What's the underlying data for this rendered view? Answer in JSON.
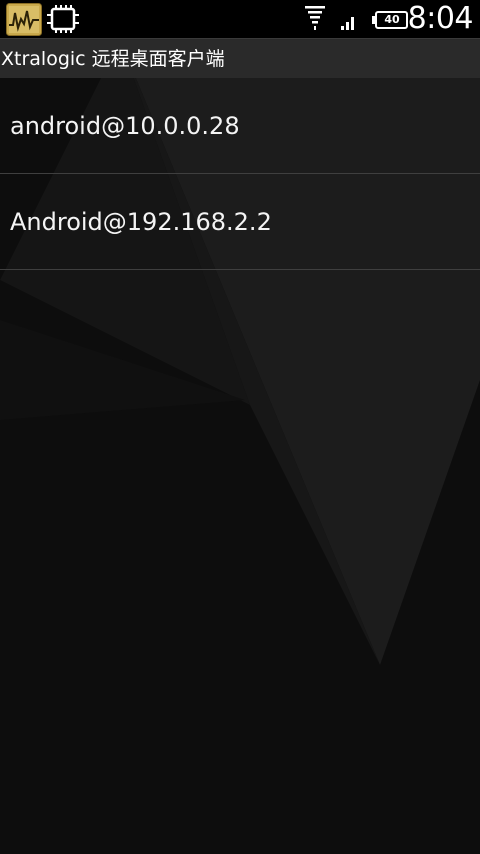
{
  "status_bar": {
    "icons": [
      "system-monitor-icon",
      "chip-icon",
      "wifi-icon",
      "signal-icon",
      "battery-icon"
    ],
    "battery_level": "40",
    "time": "8:04"
  },
  "title_bar": {
    "title": "Xtralogic 远程桌面客户端"
  },
  "hosts": [
    {
      "label": "android@10.0.0.28"
    },
    {
      "label": "Android@192.168.2.2"
    }
  ],
  "colors": {
    "background": "#0c0c0c",
    "status_bar": "#000000",
    "title_bar": "#2a2a2a",
    "divider": "#3f3f3f",
    "text": "#ffffff",
    "app_icon_gold": "#c8a84a"
  }
}
